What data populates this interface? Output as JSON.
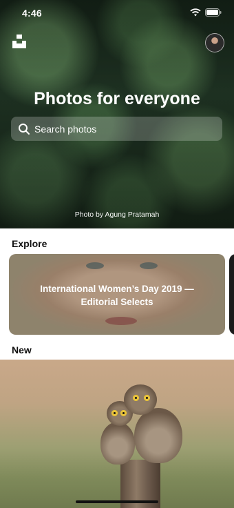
{
  "status_bar": {
    "time": "4:46"
  },
  "hero": {
    "title": "Photos for everyone",
    "credit": "Photo by Agung Pratamah"
  },
  "search": {
    "placeholder": "Search photos"
  },
  "sections": {
    "explore": "Explore",
    "new": "New"
  },
  "explore_card": {
    "title": "International Women’s Day 2019 — Editorial Selects"
  },
  "icons": {
    "logo": "unsplash-logo-icon",
    "wifi": "wifi-icon",
    "battery": "battery-icon",
    "search": "search-icon"
  },
  "colors": {
    "hero_bg": "#1f3323",
    "text_primary": "#111111",
    "white": "#ffffff"
  }
}
